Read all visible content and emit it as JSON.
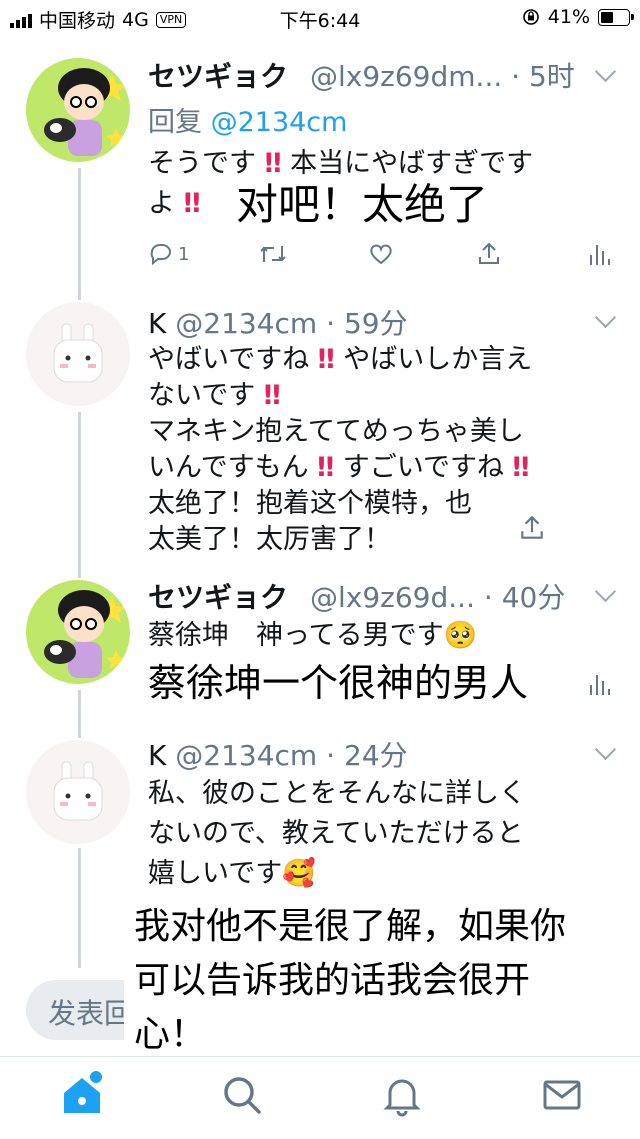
{
  "status_bar": {
    "carrier": "中国移动",
    "network": "4G",
    "vpn": "VPN",
    "time": "下午6:44",
    "battery": "41%"
  },
  "tweets": [
    {
      "name": "セツギョク",
      "handle": "@lx9z69dm...",
      "time": "5时",
      "reply_prefix": "回复",
      "reply_handle": "@2134cm",
      "text_line1": "そうです ‼ 本当にやばすぎです",
      "text_line2_prefix": "よ ‼",
      "overlay": "对吧！太绝了",
      "reply_count": "1"
    },
    {
      "name": "K",
      "handle": "@2134cm",
      "time": "59分",
      "text": "やばいですね ‼ やばいしか言え\nないです ‼\nマネキン抱えててめっちゃ美し\nいんですもん ‼ すごいですね ‼\n太绝了！抱着这个模特，也\n太美了！太厉害了！"
    },
    {
      "name": "セツギョク",
      "handle": "@lx9z69d...",
      "time": "40分",
      "text": "蔡徐坤　神ってる男です🥺",
      "overlay": "蔡徐坤一个很神的男人"
    },
    {
      "name": "K",
      "handle": "@2134cm",
      "time": "24分",
      "text": "私、彼のことをそんなに詳しく\nないので、教えていただけると\n嬉しいです🥰"
    }
  ],
  "compose": {
    "placeholder": "发表回"
  },
  "overlay_caption": "我对他不是很了解，如果你\n可以告诉我的话我会很开\n心！",
  "icons": {
    "home": "home-icon",
    "search": "search-icon",
    "notifications": "bell-icon",
    "messages": "mail-icon"
  },
  "colors": {
    "accent": "#1da1f2",
    "secondary_text": "#657786",
    "bang": "#e0245e"
  }
}
